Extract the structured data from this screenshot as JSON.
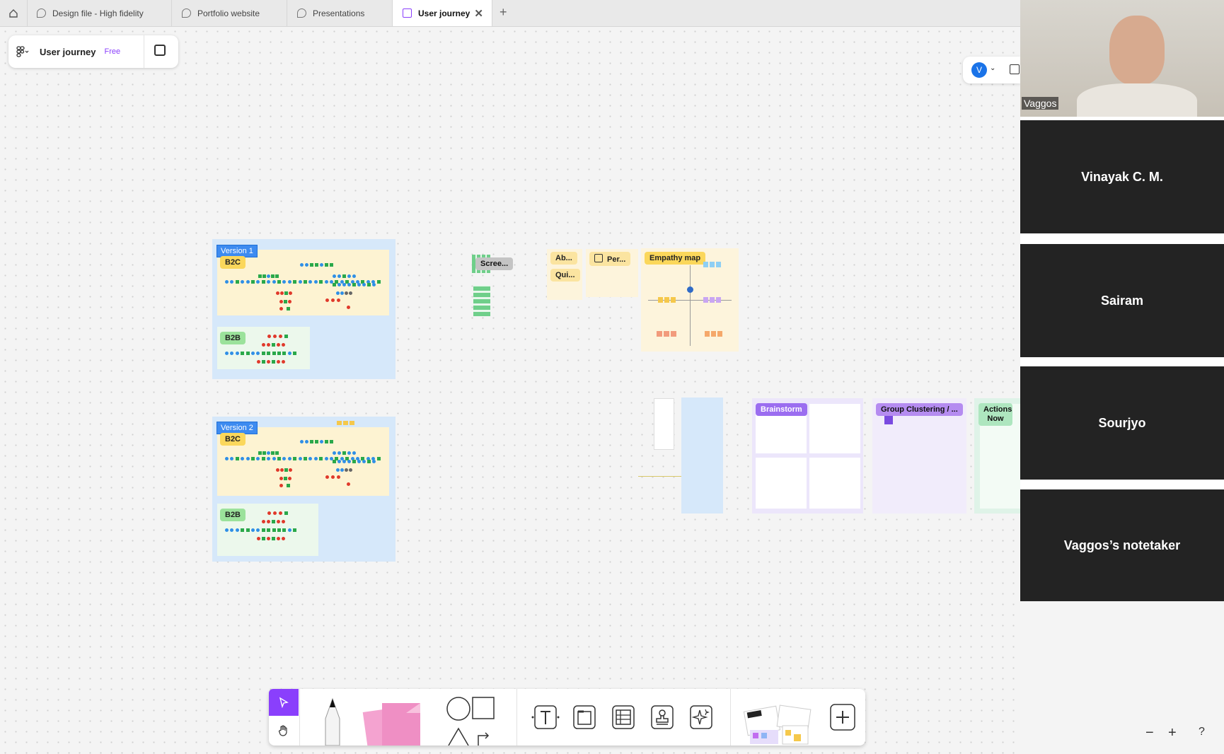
{
  "tabs": [
    {
      "label": "Design file - High fidelity"
    },
    {
      "label": "Portfolio website"
    },
    {
      "label": "Presentations"
    },
    {
      "label": "User journey"
    }
  ],
  "file": {
    "name": "User journey",
    "plan": "Free"
  },
  "user": {
    "initial": "V"
  },
  "board": {
    "v1_label": "Version 1",
    "v2_label": "Version 2",
    "b2c": "B2C",
    "b2b": "B2B",
    "screens": "Scree...",
    "about": "Ab...",
    "quiz": "Qui...",
    "persona": "Per...",
    "empathy": "Empathy map",
    "brainstorm": "Brainstorm",
    "group": "Group Clustering / ...",
    "actions": "Actions Now"
  },
  "participants": [
    {
      "name": "Vaggos"
    },
    {
      "name": "Vinayak C. M."
    },
    {
      "name": "Sairam"
    },
    {
      "name": "Sourjyo"
    },
    {
      "name": "Vaggos’s notetaker"
    }
  ],
  "toolbar": {
    "tools": [
      "select-tool",
      "hand-tool",
      "pen-tool",
      "sticky-note-tool",
      "shape-tool",
      "text-tool",
      "section-tool",
      "table-tool",
      "stamp-tool",
      "ai-tool",
      "templates-tool",
      "more-tool"
    ]
  },
  "zoom": {
    "out": "−",
    "in": "+",
    "help": "?"
  },
  "colors": {
    "accent": "#8a3ffc",
    "frame_blue": "#d6e8fa",
    "b2c_bg": "#fdf3d2",
    "b2b_bg": "#ecf8ec"
  }
}
